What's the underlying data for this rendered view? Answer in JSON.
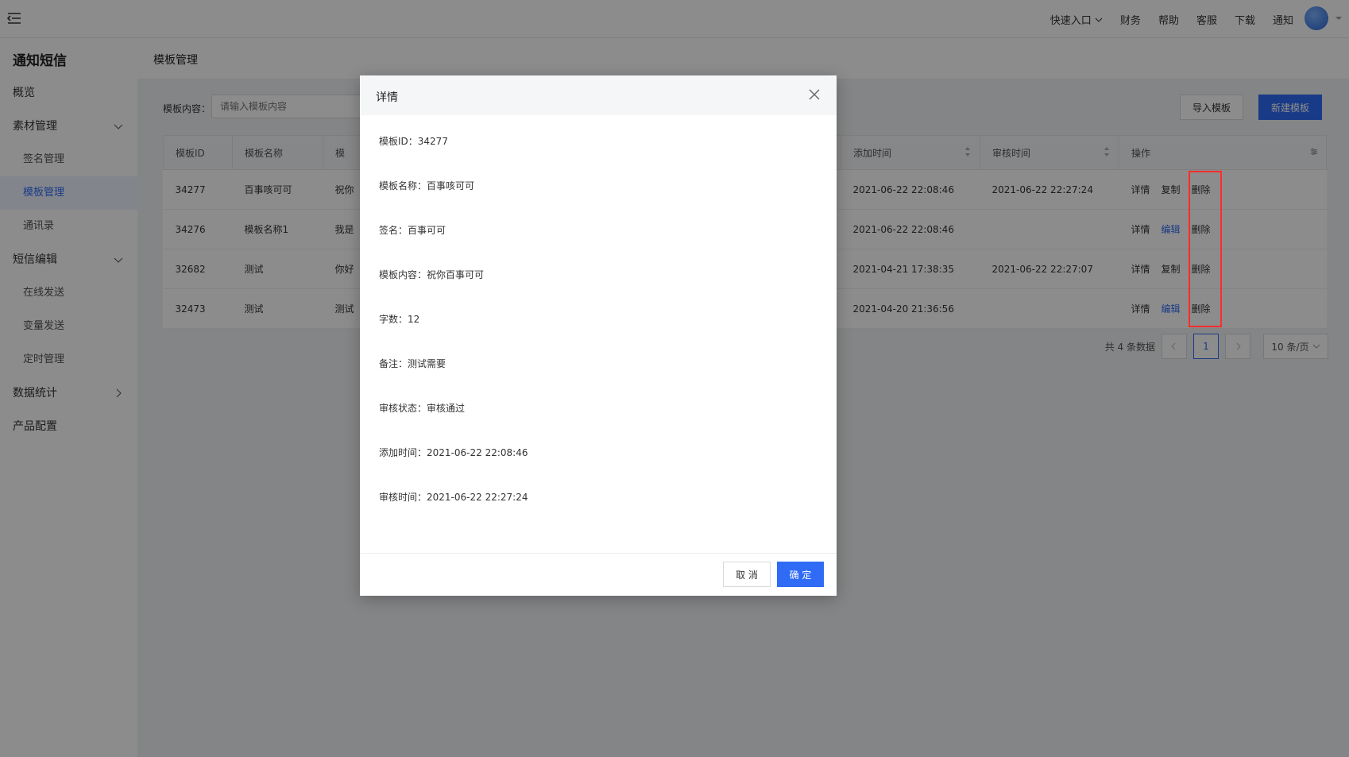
{
  "topbar": {
    "quick_entry": "快速入口",
    "links": [
      "财务",
      "帮助",
      "客服",
      "下载",
      "通知"
    ]
  },
  "sidebar": {
    "brand": "通知短信",
    "items": [
      {
        "label": "概览",
        "type": "item"
      },
      {
        "label": "素材管理",
        "type": "group",
        "expanded": true
      },
      {
        "label": "签名管理",
        "type": "sub"
      },
      {
        "label": "模板管理",
        "type": "sub",
        "active": true
      },
      {
        "label": "通讯录",
        "type": "sub"
      },
      {
        "label": "短信编辑",
        "type": "group",
        "expanded": true
      },
      {
        "label": "在线发送",
        "type": "sub"
      },
      {
        "label": "变量发送",
        "type": "sub"
      },
      {
        "label": "定时管理",
        "type": "sub"
      },
      {
        "label": "数据统计",
        "type": "group",
        "expanded": false
      },
      {
        "label": "产品配置",
        "type": "item"
      }
    ]
  },
  "page": {
    "title": "模板管理",
    "filter_label": "模板内容：",
    "filter_placeholder": "请输入模板内容",
    "import_button": "导入模板",
    "new_button": "新建模板"
  },
  "table": {
    "headers": [
      "模板ID",
      "模板名称",
      "模",
      "添加时间",
      "审核时间",
      "操作"
    ],
    "rows": [
      {
        "id": "34277",
        "name": "百事咳可可",
        "content": "祝你",
        "added": "2021-06-22 22:08:46",
        "reviewed": "2021-06-22 22:27:24",
        "ops": [
          "详情",
          "复制",
          "删除"
        ]
      },
      {
        "id": "34276",
        "name": "模板名称1",
        "content": "我是",
        "added": "2021-06-22 22:08:46",
        "reviewed": "",
        "ops": [
          "详情",
          "编辑",
          "删除"
        ]
      },
      {
        "id": "32682",
        "name": "测试",
        "content": "你好",
        "added": "2021-04-21 17:38:35",
        "reviewed": "2021-06-22 22:27:07",
        "ops": [
          "详情",
          "复制",
          "删除"
        ]
      },
      {
        "id": "32473",
        "name": "测试",
        "content": "测试",
        "added": "2021-04-20 21:36:56",
        "reviewed": "",
        "ops": [
          "详情",
          "编辑",
          "删除"
        ]
      }
    ]
  },
  "pager": {
    "total": "共 4 条数据",
    "current": "1",
    "page_size": "10 条/页"
  },
  "modal": {
    "title": "详情",
    "fields": [
      {
        "k": "模板ID：",
        "v": "34277"
      },
      {
        "k": "模板名称：",
        "v": "百事咳可可"
      },
      {
        "k": "签名：",
        "v": "百事可可"
      },
      {
        "k": "模板内容：",
        "v": "祝你百事可可"
      },
      {
        "k": "字数：",
        "v": "12"
      },
      {
        "k": "备注：",
        "v": "测试需要"
      },
      {
        "k": "审核状态：",
        "v": "审核通过"
      },
      {
        "k": "添加时间：",
        "v": "2021-06-22 22:08:46"
      },
      {
        "k": "审核时间：",
        "v": "2021-06-22 22:27:24"
      }
    ],
    "cancel": "取 消",
    "ok": "确 定"
  }
}
